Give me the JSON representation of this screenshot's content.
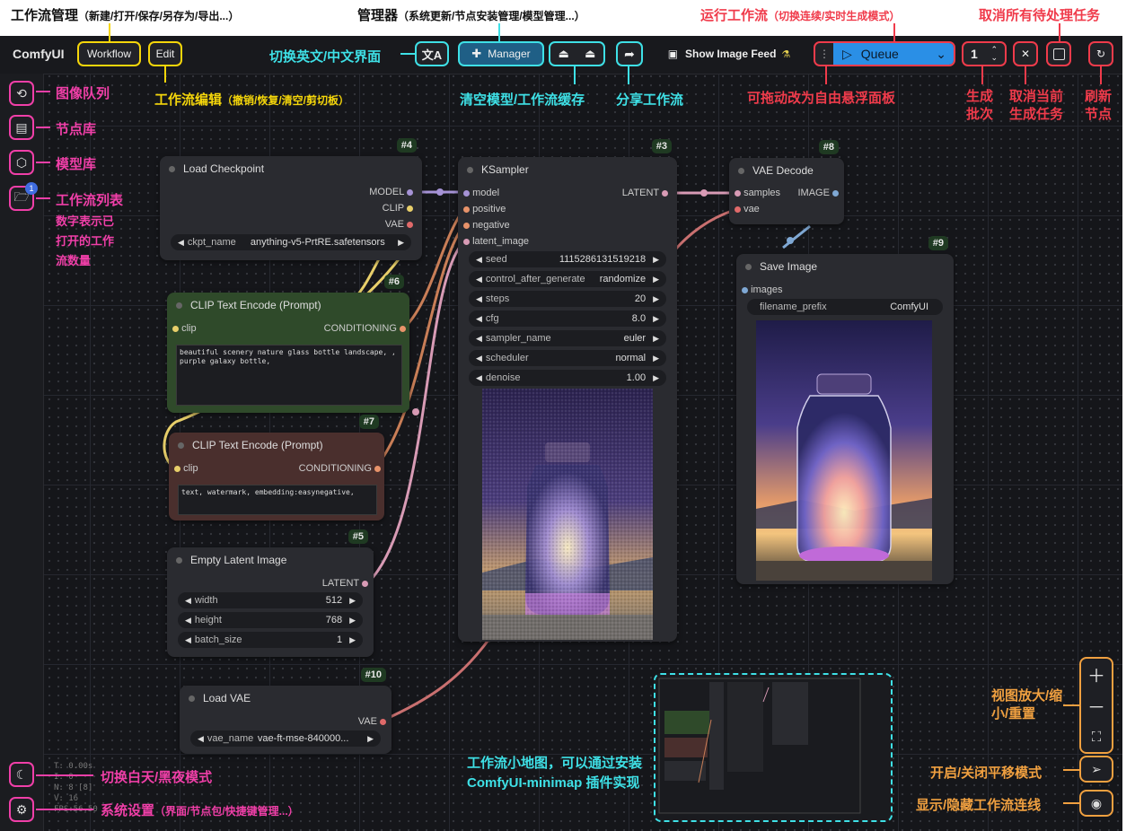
{
  "toolbar": {
    "brand": "ComfyUI",
    "workflow_label": "Workflow",
    "edit_label": "Edit",
    "manager_label": "Manager",
    "image_feed_label": "Show Image Feed",
    "queue_label": "Queue",
    "batch_count": "1"
  },
  "annotations": {
    "workflow_mgmt": "工作流管理",
    "workflow_mgmt_sub": "（新建/打开/保存/另存为/导出...）",
    "manager": "管理器",
    "manager_sub": "（系统更新/节点安装管理/模型管理...）",
    "run_workflow": "运行工作流",
    "run_workflow_sub": "（切换连续/实时生成模式）",
    "cancel_all": "取消所有待处理任务",
    "lang_switch": "切换英文/中文界面",
    "workflow_edit": "工作流编辑",
    "workflow_edit_sub": "（撤销/恢复/清空/剪切板）",
    "clear_cache": "清空模型/工作流缓存",
    "share": "分享工作流",
    "drag_panel": "可拖动改为自由悬浮面板",
    "gen_batch": "生成批次",
    "cancel_current": "取消当前生成任务",
    "refresh": "刷新节点",
    "image_queue": "图像队列",
    "node_library": "节点库",
    "model_library": "模型库",
    "workflow_list": "工作流列表",
    "workflow_list_note": "数字表示已打开的工作流数量",
    "zoom": "视图放大/缩小/重置",
    "pan_mode": "开启/关闭平移模式",
    "toggle_links": "显示/隐藏工作流连线",
    "theme": "切换白天/黑夜模式",
    "settings": "系统设置",
    "settings_sub": "（界面/节点包/快捷键管理...）",
    "minimap": "工作流小地图，可以通过安装 ComfyUI-minimap 插件实现"
  },
  "sidebar": {
    "workflow_badge": "1"
  },
  "nodes": {
    "load_checkpoint": {
      "id": "#4",
      "title": "Load Checkpoint",
      "outputs": [
        "MODEL",
        "CLIP",
        "VAE"
      ],
      "ckpt_name_label": "ckpt_name",
      "ckpt_name_value": "anything-v5-PrtRE.safetensors"
    },
    "clip_pos": {
      "id": "#6",
      "title": "CLIP Text Encode (Prompt)",
      "input": "clip",
      "output": "CONDITIONING",
      "text": "beautiful scenery nature glass bottle landscape, , purple galaxy bottle,"
    },
    "clip_neg": {
      "id": "#7",
      "title": "CLIP Text Encode (Prompt)",
      "input": "clip",
      "output": "CONDITIONING",
      "text": "text, watermark, embedding:easynegative,"
    },
    "empty_latent": {
      "id": "#5",
      "title": "Empty Latent Image",
      "output": "LATENT",
      "widgets": [
        {
          "label": "width",
          "value": "512"
        },
        {
          "label": "height",
          "value": "768"
        },
        {
          "label": "batch_size",
          "value": "1"
        }
      ]
    },
    "load_vae": {
      "id": "#10",
      "title": "Load VAE",
      "output": "VAE",
      "vae_label": "vae_name",
      "vae_value": "vae-ft-mse-840000..."
    },
    "ksampler": {
      "id": "#3",
      "title": "KSampler",
      "output": "LATENT",
      "inputs": [
        "model",
        "positive",
        "negative",
        "latent_image"
      ],
      "widgets": [
        {
          "label": "seed",
          "value": "1115286131519218"
        },
        {
          "label": "control_after_generate",
          "value": "randomize"
        },
        {
          "label": "steps",
          "value": "20"
        },
        {
          "label": "cfg",
          "value": "8.0"
        },
        {
          "label": "sampler_name",
          "value": "euler"
        },
        {
          "label": "scheduler",
          "value": "normal"
        },
        {
          "label": "denoise",
          "value": "1.00"
        }
      ]
    },
    "vae_decode": {
      "id": "#8",
      "title": "VAE Decode",
      "inputs": [
        "samples",
        "vae"
      ],
      "output": "IMAGE"
    },
    "save_image": {
      "id": "#9",
      "title": "Save Image",
      "input": "images",
      "prefix_label": "filename_prefix",
      "prefix_value": "ComfyUI"
    }
  },
  "stats": [
    "T: 0.00s",
    "I: 0",
    "N: 8 [8]",
    "V: 16",
    "FPS:56.50"
  ],
  "colors": {
    "workflow_ring": "#f5d60a",
    "cyan_ring": "#3ee0e6",
    "red_ring": "#f03b4b",
    "pink_ring": "#f03fa8",
    "orange_ring": "#f0a040",
    "queue_button": "#2a8fe6"
  }
}
